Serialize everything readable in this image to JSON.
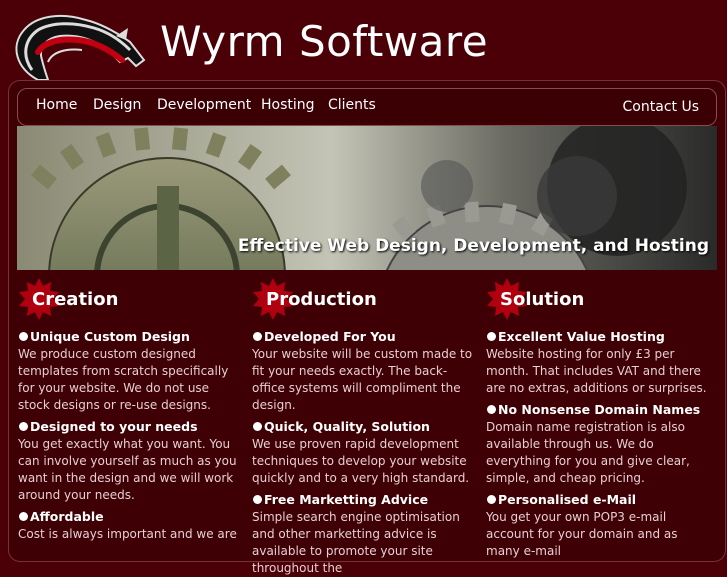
{
  "header": {
    "title": "Wyrm Software"
  },
  "nav": {
    "items": [
      "Home",
      "Design",
      "Development",
      "Hosting",
      "Clients"
    ],
    "contact": "Contact Us"
  },
  "banner": {
    "tagline": "Effective Web Design, Development, and Hosting"
  },
  "columns": [
    {
      "title": "Creation",
      "features": [
        {
          "title": "Unique Custom Design",
          "text": "We produce custom designed templates from scratch specifically for your website. We do not use stock designs or re-use designs."
        },
        {
          "title": "Designed to your needs",
          "text": "You get exactly what you want. You can involve yourself as much as you want in the design and we will work around your needs."
        },
        {
          "title": "Affordable",
          "text": "Cost is always important and we are"
        }
      ]
    },
    {
      "title": "Production",
      "features": [
        {
          "title": "Developed For You",
          "text": "Your website will be custom made to fit your needs exactly. The back-office systems will compliment the design."
        },
        {
          "title": "Quick, Quality, Solution",
          "text": "We use proven rapid development techniques to develop your website quickly and to a very high standard."
        },
        {
          "title": "Free Marketting Advice",
          "text": "Simple search engine optimisation and other marketting advice is available to promote your site throughout the"
        }
      ]
    },
    {
      "title": "Solution",
      "features": [
        {
          "title": "Excellent Value Hosting",
          "text": "Website hosting for only £3 per month. That includes VAT and there are no extras, additions or surprises."
        },
        {
          "title": "No Nonsense Domain Names",
          "text": "Domain name registration is also available through us. We do everything for you and give clear, simple, and cheap pricing."
        },
        {
          "title": "Personalised e-Mail",
          "text": "You get your own POP3 e-mail account for your domain and as many e-mail"
        }
      ]
    }
  ],
  "colors": {
    "background": "#4a0006",
    "accent": "#b00010",
    "text_muted": "#e6cfd1"
  },
  "icons": {
    "logo": "dragon-logo",
    "bullet": "bullet-dot",
    "heading": "starburst"
  }
}
